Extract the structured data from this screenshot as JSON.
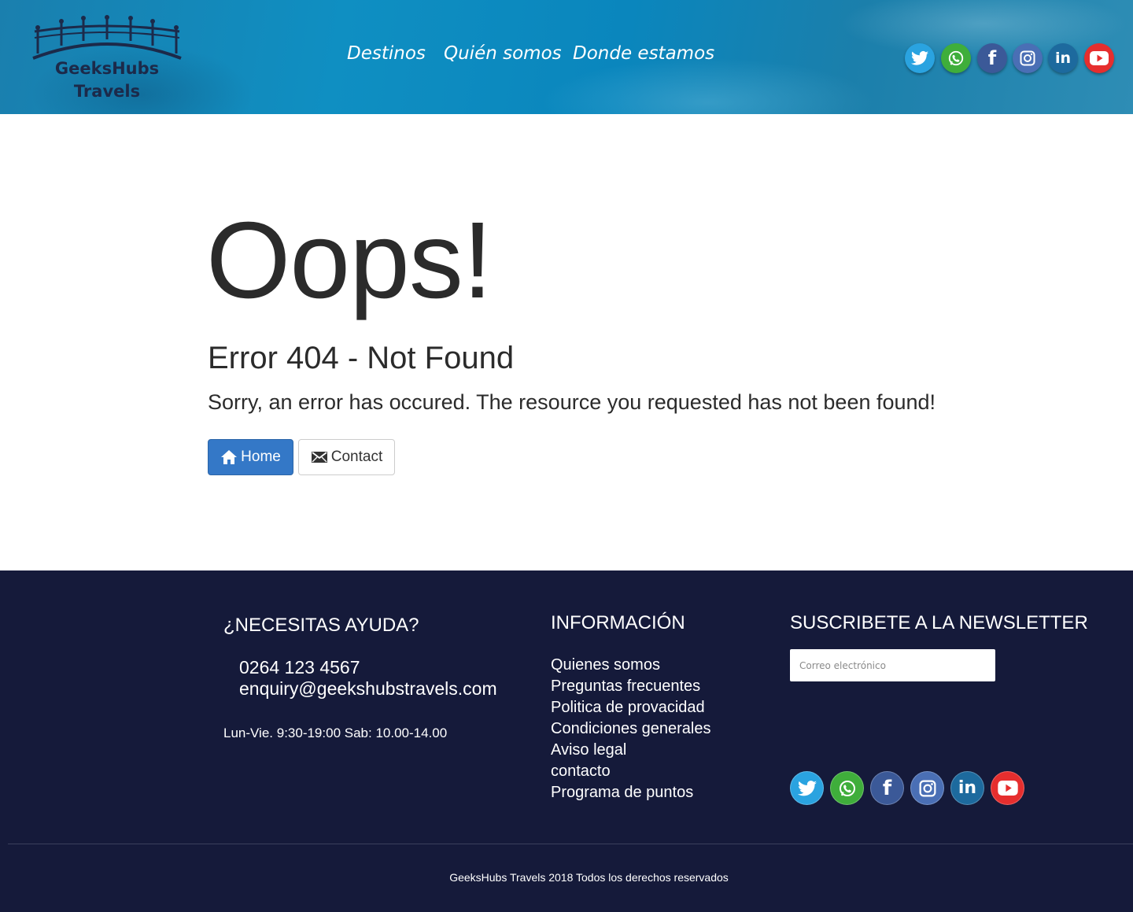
{
  "header": {
    "logo_line1": "GeeksHubs",
    "logo_line2": "Travels",
    "nav": [
      "Destinos",
      "Quién somos",
      "Donde estamos"
    ]
  },
  "social": [
    {
      "name": "twitter",
      "color": "#2aa3e0"
    },
    {
      "name": "whatsapp",
      "color": "#3fae3b"
    },
    {
      "name": "facebook",
      "color": "#3b5998"
    },
    {
      "name": "instagram",
      "color": "#4a6fb5"
    },
    {
      "name": "linkedin",
      "color": "#1d6a9e"
    },
    {
      "name": "youtube",
      "color": "#e62e2e"
    }
  ],
  "main": {
    "oops": "Oops!",
    "title": "Error 404 - Not Found",
    "description": "Sorry, an error has occured. The resource you requested has not been found!",
    "home_label": "Home",
    "contact_label": "Contact",
    "home_button_color": "#3478c7"
  },
  "footer": {
    "background": "#151a3a",
    "help_heading": "¿NECESITAS AYUDA?",
    "phone": "0264 123 4567",
    "email": "enquiry@geekshubstravels.com",
    "hours": "Lun-Vie. 9:30-19:00 Sab: 10.00-14.00",
    "info_heading": "INFORMACIÓN",
    "info_links": [
      "Quienes somos",
      "Preguntas frecuentes",
      "Politica de provacidad",
      "Condiciones generales",
      "Aviso legal",
      "contacto",
      "Programa de puntos"
    ],
    "newsletter_heading": "SUSCRIBETE A LA NEWSLETTER",
    "newsletter_placeholder": "Correo electrónico",
    "copyright": "GeeksHubs Travels 2018 Todos los derechos reservados"
  }
}
